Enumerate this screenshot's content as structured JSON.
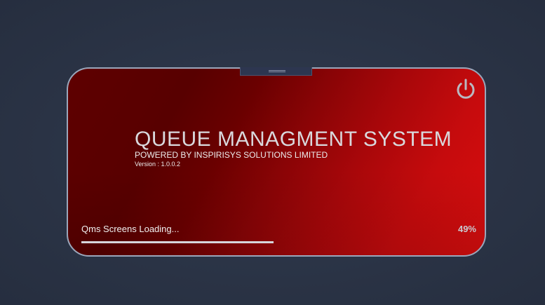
{
  "app": {
    "title": "QUEUE MANAGMENT SYSTEM",
    "subtitle": "POWERED BY INSPIRISYS SOLUTIONS LIMITED",
    "version": "Version : 1.0.0.2"
  },
  "loading": {
    "status_text": "Qms Screens Loading...",
    "percent_text": "49%",
    "progress_fraction": 0.49
  },
  "icons": {
    "power": "power-icon",
    "drag_handle": "drag-handle-icon"
  },
  "colors": {
    "background": "#2b3447",
    "panel_dark_red": "#5e0000",
    "panel_bright_red": "#d80d0e",
    "panel_border": "#9aa7bb",
    "text": "#d9d9dd"
  }
}
